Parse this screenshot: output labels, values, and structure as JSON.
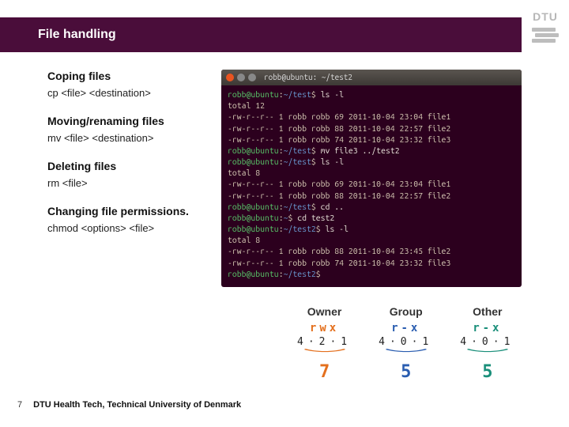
{
  "header": {
    "title": "File handling"
  },
  "logo": {
    "text": "DTU"
  },
  "sections": {
    "copy": {
      "heading": "Coping files",
      "cmd": "cp <file> <destination>"
    },
    "move": {
      "heading": "Moving/renaming files",
      "cmd": "mv <file> <destination>"
    },
    "delete": {
      "heading": "Deleting files",
      "cmd": "rm <file>"
    },
    "chmod": {
      "heading": "Changing file permissions.",
      "cmd": "chmod <options> <file>"
    }
  },
  "terminal": {
    "title": "robb@ubuntu: ~/test2",
    "user": "robb@ubuntu",
    "lines": [
      {
        "path": "~/test",
        "cmd": "ls -l"
      },
      {
        "text": "total 12"
      },
      {
        "text": "-rw-r--r-- 1 robb robb 69 2011-10-04 23:04 file1"
      },
      {
        "text": "-rw-r--r-- 1 robb robb 88 2011-10-04 22:57 file2"
      },
      {
        "text": "-rw-r--r-- 1 robb robb 74 2011-10-04 23:32 file3"
      },
      {
        "path": "~/test",
        "cmd": "mv file3 ../test2"
      },
      {
        "path": "~/test",
        "cmd": "ls -l"
      },
      {
        "text": "total 8"
      },
      {
        "text": "-rw-r--r-- 1 robb robb 69 2011-10-04 23:04 file1"
      },
      {
        "text": "-rw-r--r-- 1 robb robb 88 2011-10-04 22:57 file2"
      },
      {
        "path": "~/test",
        "cmd": "cd .."
      },
      {
        "path": "~",
        "cmd": "cd test2"
      },
      {
        "path": "~/test2",
        "cmd": "ls -l"
      },
      {
        "text": "total 8"
      },
      {
        "text": "-rw-r--r-- 1 robb robb 88 2011-10-04 23:45 file2"
      },
      {
        "text": "-rw-r--r-- 1 robb robb 74 2011-10-04 23:32 file3"
      },
      {
        "path": "~/test2",
        "cmd": ""
      }
    ]
  },
  "chmod_fig": {
    "cols": [
      {
        "label": "Owner",
        "rwx": "rwx",
        "vals": "4·2·1",
        "digit": "7"
      },
      {
        "label": "Group",
        "rwx": "r-x",
        "vals": "4·0·1",
        "digit": "5"
      },
      {
        "label": "Other",
        "rwx": "r-x",
        "vals": "4·0·1",
        "digit": "5"
      }
    ]
  },
  "footer": {
    "page": "7",
    "text": "DTU Health Tech, Technical University of Denmark"
  }
}
